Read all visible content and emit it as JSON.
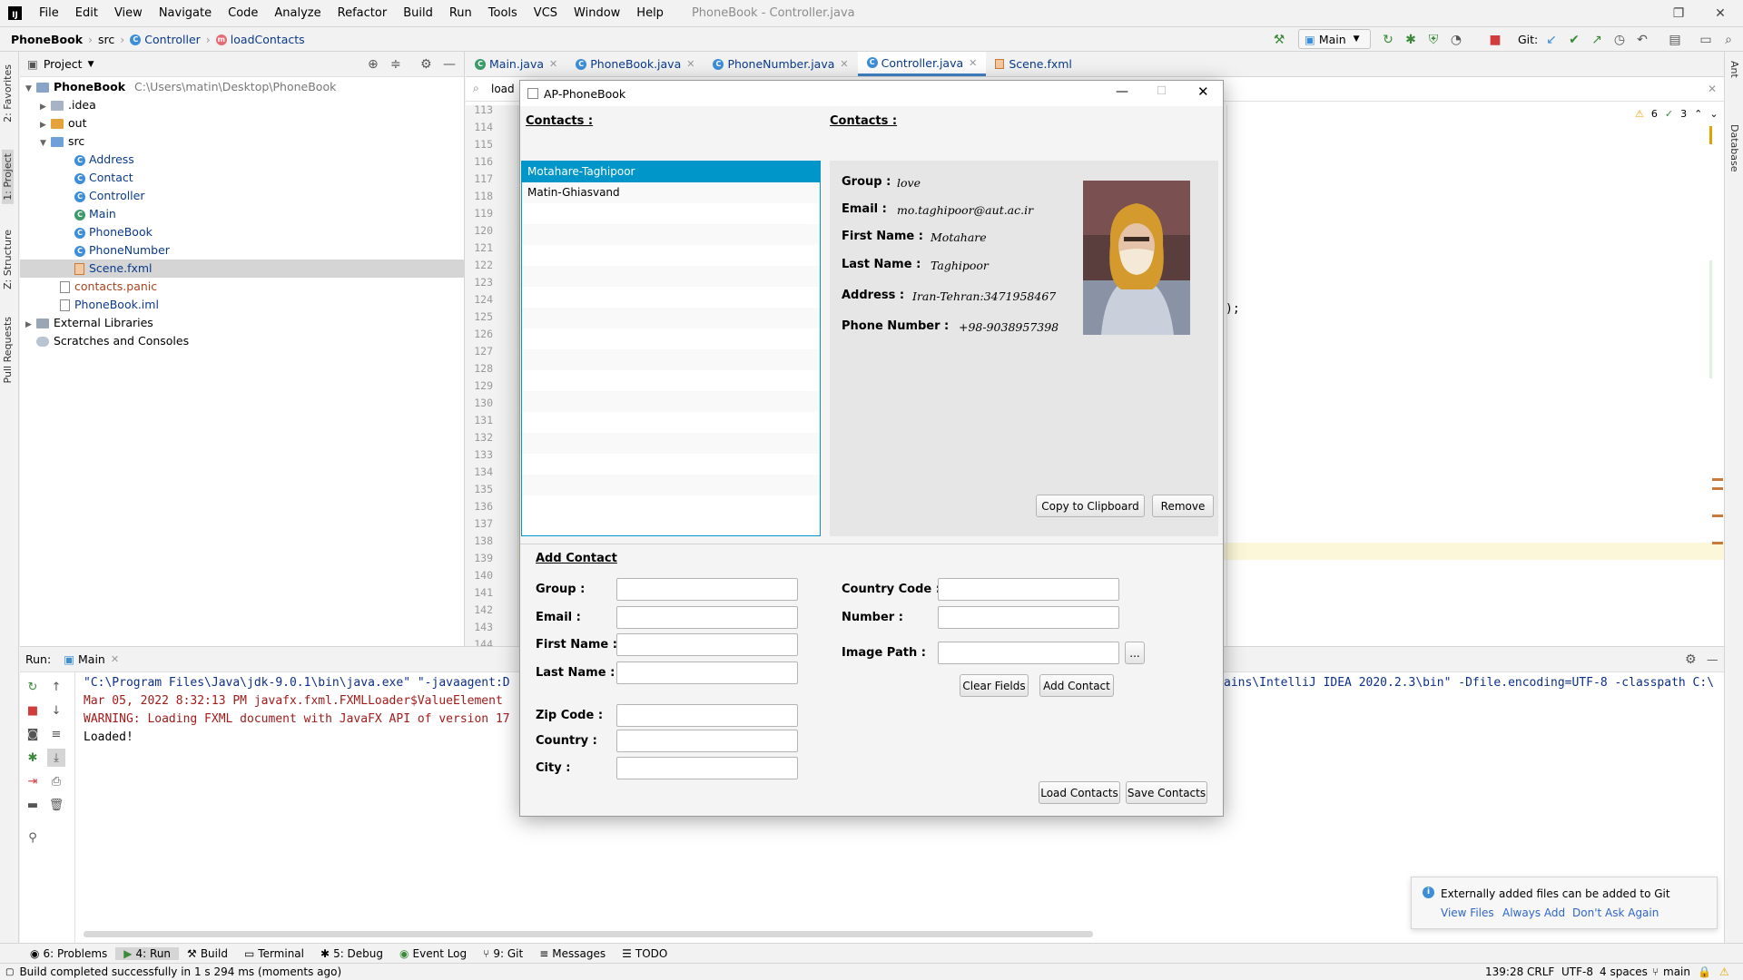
{
  "menu": {
    "items": [
      "File",
      "Edit",
      "View",
      "Navigate",
      "Code",
      "Analyze",
      "Refactor",
      "Build",
      "Run",
      "Tools",
      "VCS",
      "Window",
      "Help"
    ],
    "window_title": "PhoneBook - Controller.java"
  },
  "breadcrumb": {
    "project": "PhoneBook",
    "folder": "src",
    "class": "Controller",
    "method": "loadContacts"
  },
  "toolbar": {
    "run_config": "Main",
    "git_label": "Git:"
  },
  "project_panel": {
    "title": "Project",
    "root_name": "PhoneBook",
    "root_path": "C:\\Users\\matin\\Desktop\\PhoneBook",
    "items": [
      {
        "label": "PhoneBook",
        "kind": "root"
      },
      {
        "label": ".idea",
        "kind": "folder"
      },
      {
        "label": "out",
        "kind": "folder-orange"
      },
      {
        "label": "src",
        "kind": "folder-open"
      },
      {
        "label": "Address",
        "kind": "class"
      },
      {
        "label": "Contact",
        "kind": "class"
      },
      {
        "label": "Controller",
        "kind": "class"
      },
      {
        "label": "Main",
        "kind": "main"
      },
      {
        "label": "PhoneBook",
        "kind": "class"
      },
      {
        "label": "PhoneNumber",
        "kind": "class"
      },
      {
        "label": "Scene.fxml",
        "kind": "fxml"
      },
      {
        "label": "contacts.panic",
        "kind": "file"
      },
      {
        "label": "PhoneBook.iml",
        "kind": "file"
      },
      {
        "label": "External Libraries",
        "kind": "lib"
      },
      {
        "label": "Scratches and Consoles",
        "kind": "scratch"
      }
    ]
  },
  "left_tabs": [
    "2: Favorites",
    "1: Project",
    "Z: Structure",
    "Pull Requests"
  ],
  "right_tabs": [
    "Ant",
    "Database"
  ],
  "editor": {
    "tabs": [
      "Main.java",
      "PhoneBook.java",
      "PhoneNumber.java",
      "Controller.java",
      "Scene.fxml"
    ],
    "active_tab": "Controller.java",
    "search_text": "load",
    "line_numbers": [
      "113",
      "114",
      "115",
      "116",
      "117",
      "118",
      "119",
      "120",
      "121",
      "122",
      "123",
      "124",
      "125",
      "126",
      "127",
      "128",
      "129",
      "130",
      "131",
      "132",
      "133",
      "134",
      "135",
      "136",
      "137",
      "138",
      "139",
      "140",
      "141",
      "142",
      "143",
      "144"
    ],
    "visible_code": ");",
    "warnings": "6",
    "checks": "3"
  },
  "run_panel": {
    "label": "Run:",
    "tab": "Main",
    "lines": [
      {
        "text": "\"C:\\Program Files\\Java\\jdk-9.0.1\\bin\\java.exe\" \"-javaagent:D",
        "color": "#0b2f8a"
      },
      {
        "text": "Mar 05, 2022 8:32:13 PM javafx.fxml.FXMLLoader$ValueElement",
        "color": "#a11b1b"
      },
      {
        "text": "WARNING: Loading FXML document with JavaFX API of version 17",
        "color": "#a11b1b"
      },
      {
        "text": "Loaded!",
        "color": "#000000"
      }
    ],
    "tail_line": "ains\\IntelliJ IDEA 2020.2.3\\bin\" -Dfile.encoding=UTF-8 -classpath C:\\"
  },
  "bottom_tabs": [
    "6: Problems",
    "4: Run",
    "Build",
    "Terminal",
    "5: Debug",
    "Event Log",
    "9: Git",
    "Messages",
    "TODO"
  ],
  "status": {
    "message": "Build completed successfully in 1 s 294 ms (moments ago)",
    "position": "139:28",
    "line_sep": "CRLF",
    "encoding": "UTF-8",
    "indent": "4 spaces",
    "branch": "main"
  },
  "notification": {
    "text": "Externally added files can be added to Git",
    "actions": [
      "View Files",
      "Always Add",
      "Don't Ask Again"
    ]
  },
  "dialog": {
    "title": "AP-PhoneBook",
    "contacts_header_left": "Contacts :",
    "contacts_header_right": "Contacts :",
    "contacts": [
      "Motahare-Taghipoor",
      "Matin-Ghiasvand"
    ],
    "selected_contact": "Motahare-Taghipoor",
    "details": {
      "group_label": "Group :",
      "group": "love",
      "email_label": "Email :",
      "email": "mo.taghipoor@aut.ac.ir",
      "first_label": "First Name :",
      "first": "Motahare",
      "last_label": "Last Name :",
      "last": "Taghipoor",
      "address_label": "Address :",
      "address": "Iran-Tehran:3471958467",
      "phone_label": "Phone Number :",
      "phone": "+98-9038957398"
    },
    "copy_button": "Copy to Clipboard",
    "remove_button": "Remove",
    "add_header": "Add Contact",
    "form": {
      "group": "Group :",
      "email": "Email :",
      "first": "First Name :",
      "last": "Last Name :",
      "zip": "Zip Code :",
      "country": "Country :",
      "city": "City :",
      "country_code": "Country Code :",
      "number": "Number :",
      "image_path": "Image Path :",
      "browse": "..."
    },
    "clear_button": "Clear Fields",
    "add_button": "Add Contact",
    "load_button": "Load Contacts",
    "save_button": "Save Contacts"
  }
}
